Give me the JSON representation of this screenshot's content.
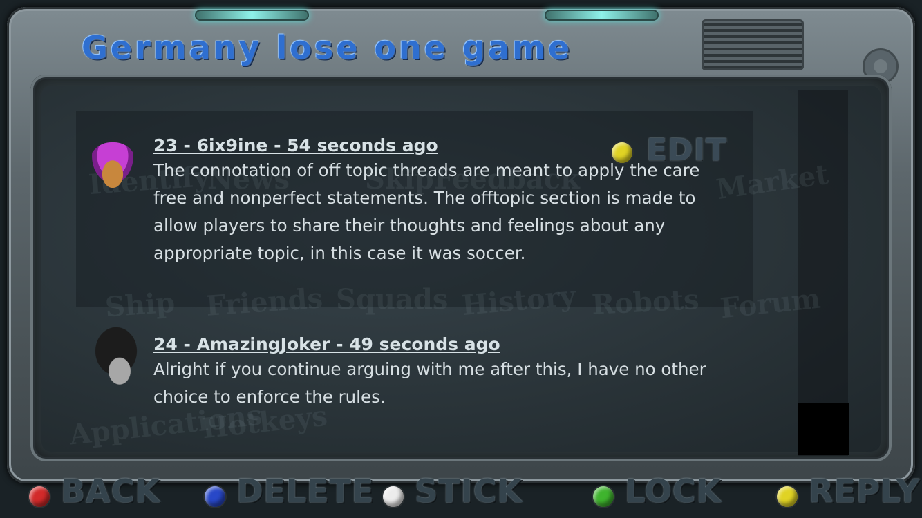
{
  "thread": {
    "title": "Germany lose one game"
  },
  "posts": [
    {
      "header": "23 - 6ix9ine - 54 seconds ago",
      "body": "The connotation of off topic threads are meant to apply the care free and nonperfect statements. The offtopic section is made to allow players to share their thoughts and feelings about any appropriate topic, in this case it was soccer."
    },
    {
      "header": "24 - AmazingJoker - 49 seconds ago",
      "body": "Alright if you continue arguing with me after this, I have no other choice to enforce the rules."
    }
  ],
  "edit_label": "EDIT",
  "buttons": {
    "back": "BACK",
    "delete": "DELETE",
    "stick": "STICK",
    "lock": "LOCK",
    "reply": "REPLY"
  },
  "background_words": [
    "Identify",
    "News",
    "SkipFeedback",
    "Market",
    "Ship",
    "Friends",
    "Squads",
    "History",
    "Robots",
    "Forum",
    "Applications",
    "Hotkeys"
  ],
  "colors": {
    "title": "#2f6fd0",
    "back_dot": "#d22a2a",
    "delete_dot": "#2848c8",
    "stick_dot": "#ececec",
    "lock_dot": "#3fb42e",
    "reply_dot": "#e0d324",
    "edit_dot": "#e0d324"
  }
}
